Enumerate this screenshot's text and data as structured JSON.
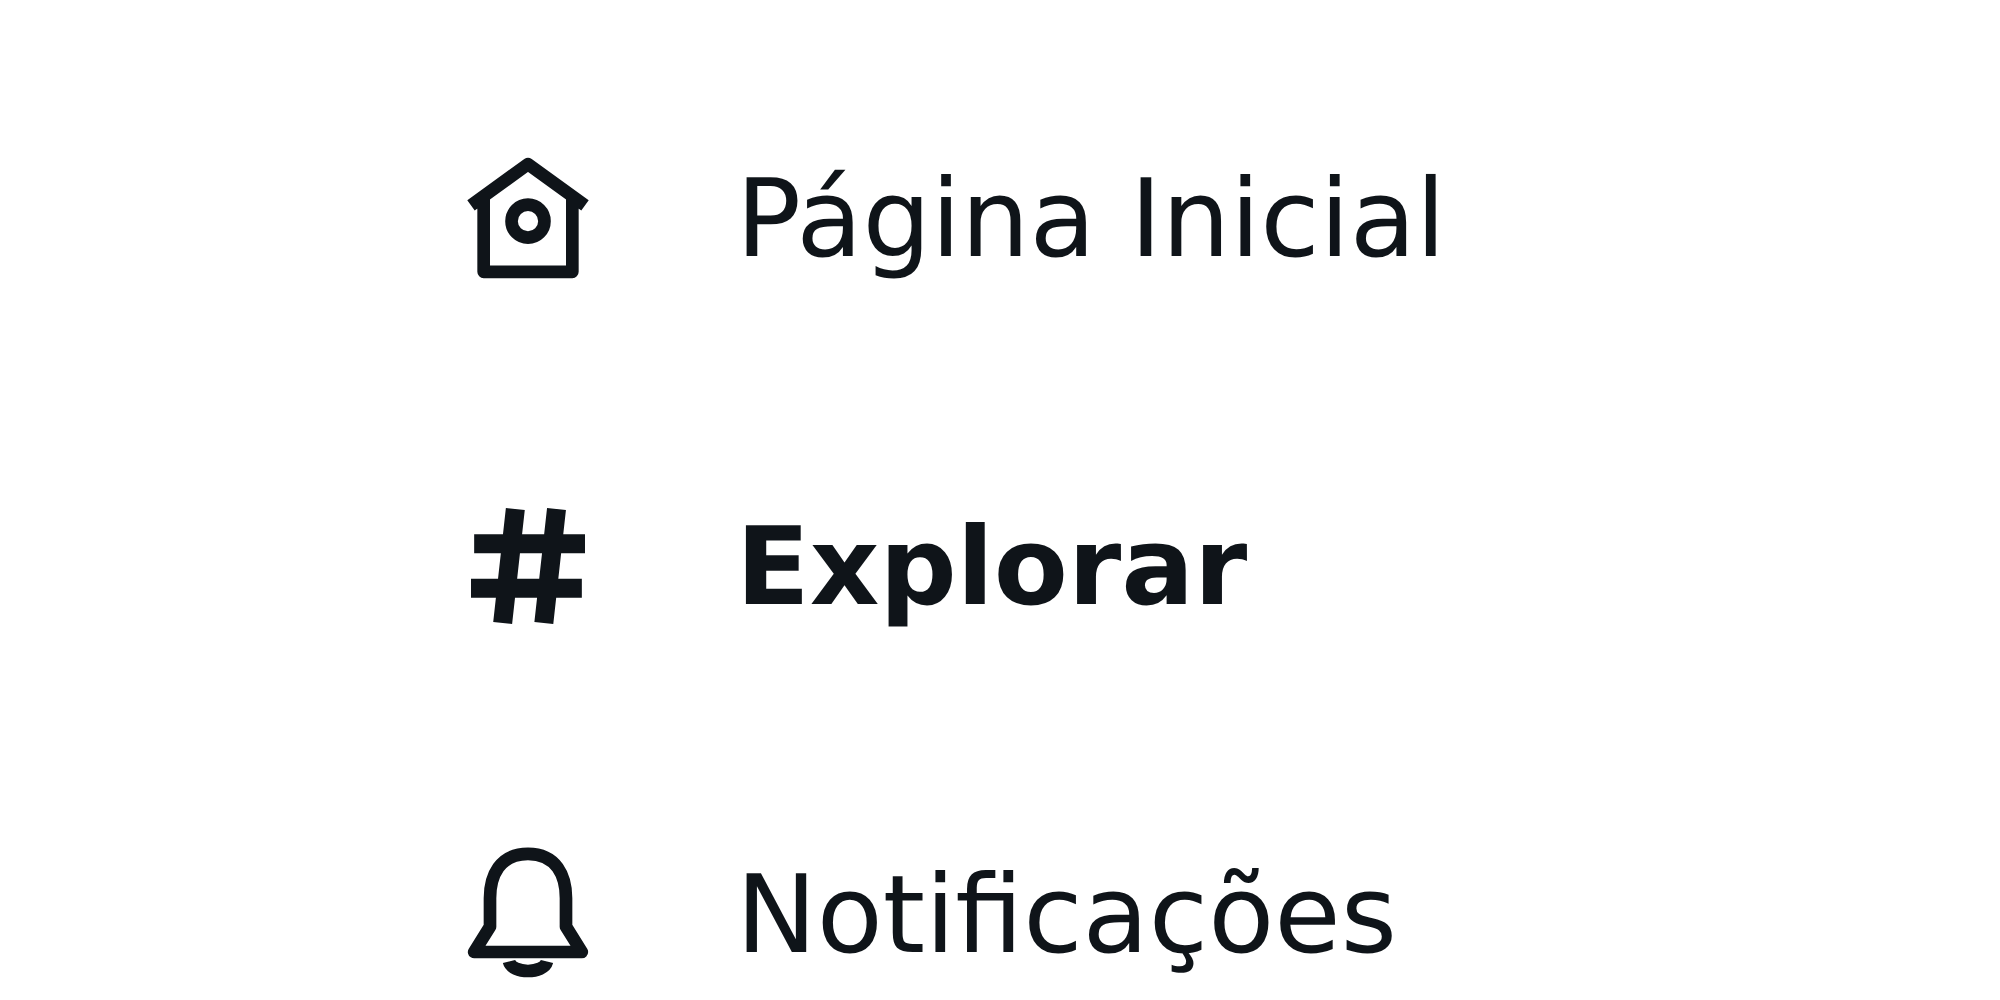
{
  "nav": [
    {
      "kind": "home",
      "label": "Página Inicial",
      "selected": false
    },
    {
      "kind": "hash",
      "label": "Explorar",
      "selected": true
    },
    {
      "kind": "bell",
      "label": "Notificações",
      "selected": false
    }
  ]
}
